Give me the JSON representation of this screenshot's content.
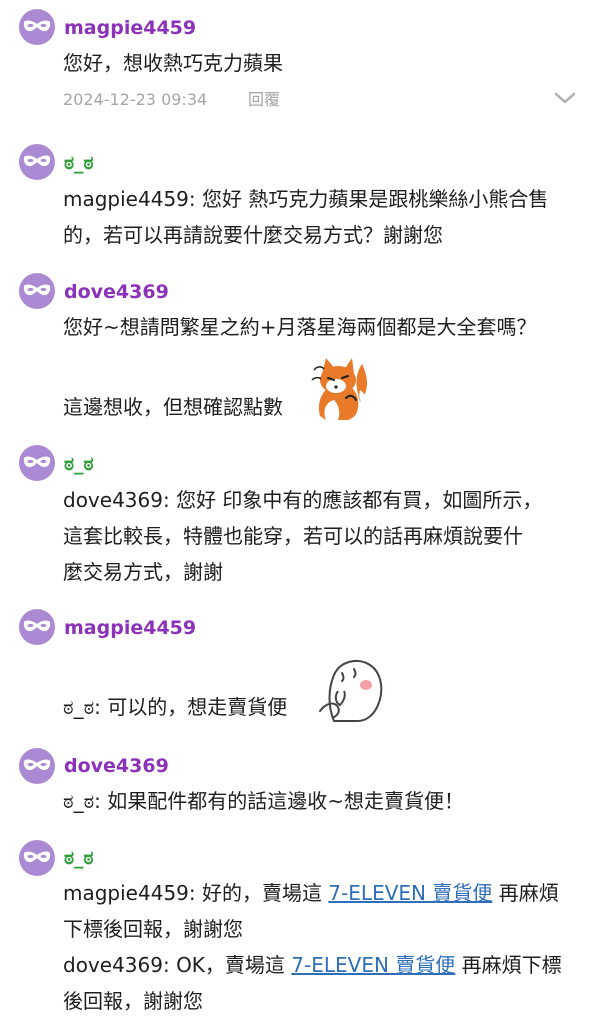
{
  "comments": [
    {
      "username": "magpie4459",
      "lines": [
        "您好，想收熱巧克力蘋果"
      ],
      "timestamp": "2024-12-23 09:34",
      "reply_label": "回覆",
      "icon": "chevron-down-icon"
    },
    {
      "username": "ಠ_ಠ",
      "lines": [
        "magpie4459: 您好 熱巧克力蘋果是跟桃樂絲小熊合售",
        "的，若可以再請說要什麼交易方式？謝謝您"
      ]
    },
    {
      "username": "dove4369",
      "lines": [
        "您好~想請問繁星之約+月落星海兩個都是大全套嗎？",
        "這邊想收，但想確認點數"
      ],
      "sticker": "fox-sticker"
    },
    {
      "username": "ಠ_ಠ",
      "lines": [
        "dove4369: 您好 印象中有的應該都有買，如圖所示，",
        "這套比較長，特體也能穿，若可以的話再麻煩說要什",
        "麼交易方式，謝謝"
      ]
    },
    {
      "username": "magpie4459",
      "lines": [
        "ಠ_ಠ: 可以的，想走賣貨便"
      ],
      "sticker": "ghost-sticker"
    },
    {
      "username": "dove4369",
      "lines": [
        "ಠ_ಠ: 如果配件都有的話這邊收~想走賣貨便！"
      ]
    },
    {
      "username": "ಠ_ಠ",
      "line1_prefix": "magpie4459: 好的，賣場這 ",
      "line1_link": "7-ELEVEN 賣貨便",
      "line1_suffix": " 再麻煩",
      "line2": "下標後回報，謝謝您",
      "line3_prefix": "dove4369: OK，賣場這 ",
      "line3_link": "7-ELEVEN 賣貨便",
      "line3_suffix": " 再麻煩下標",
      "line4": "後回報，謝謝您"
    }
  ],
  "colors": {
    "avatar": "#ab8ad4",
    "username_purple": "#8b32b8",
    "username_green": "#2e9e3a",
    "link": "#2f6fb9",
    "meta": "#a6a6a6"
  },
  "icons": {
    "avatar": "mask-icon",
    "expand": "chevron-down-icon"
  }
}
